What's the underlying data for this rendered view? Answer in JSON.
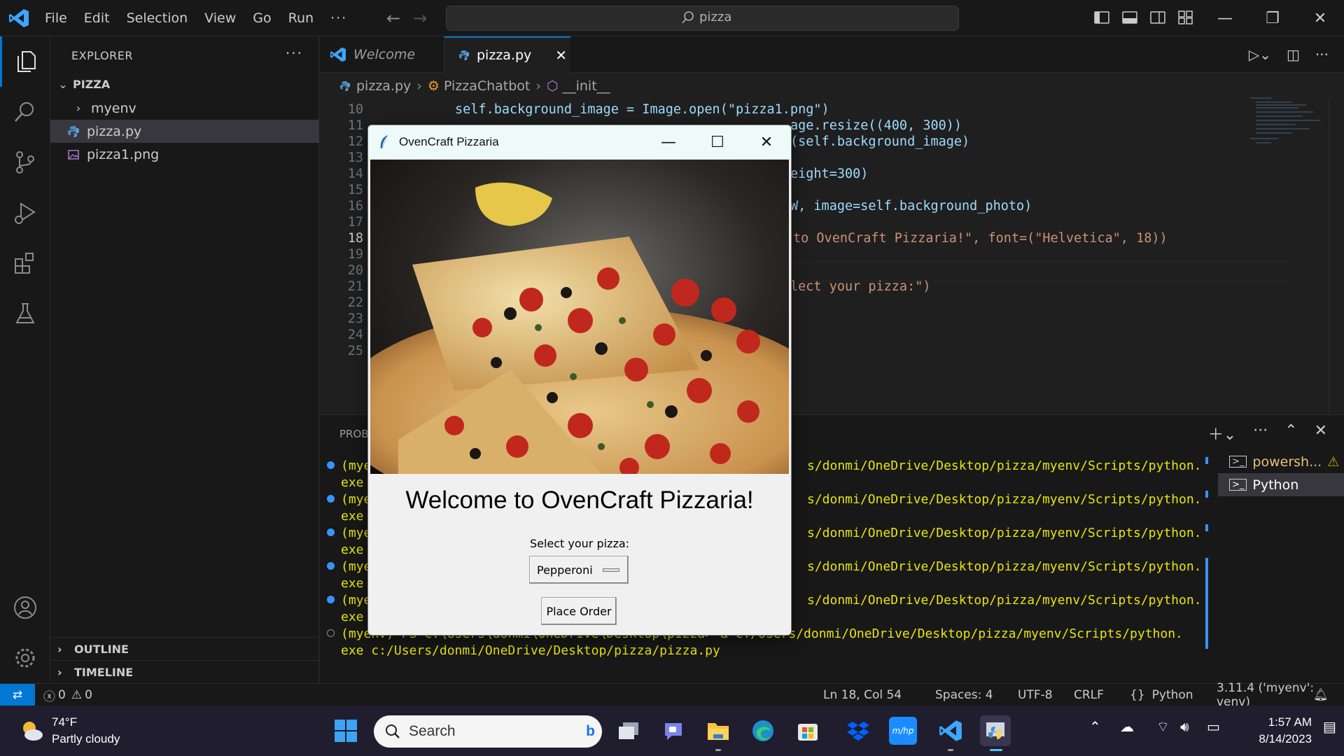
{
  "app": {
    "menu": [
      "File",
      "Edit",
      "Selection",
      "View",
      "Go",
      "Run"
    ],
    "search_text": "pizza",
    "accent": "#0078d4"
  },
  "explorer": {
    "header": "EXPLORER",
    "root": "PIZZA",
    "items": [
      {
        "label": "myenv",
        "type": "folder"
      },
      {
        "label": "pizza.py",
        "type": "python-file"
      },
      {
        "label": "pizza1.png",
        "type": "image-file"
      }
    ],
    "outline": "OUTLINE",
    "timeline": "TIMELINE"
  },
  "tabs": [
    {
      "label": "Welcome"
    },
    {
      "label": "pizza.py"
    }
  ],
  "breadcrumb": [
    "pizza.py",
    "PizzaChatbot",
    "__init__"
  ],
  "code": {
    "current_line": 18,
    "lines": [
      {
        "n": "10",
        "text": "self.background_image = Image.open(\"pizza1.png\")"
      },
      {
        "n": "11",
        "text": "age.resize((400, 300))"
      },
      {
        "n": "12",
        "text": "(self.background_image)"
      },
      {
        "n": "13",
        "text": ""
      },
      {
        "n": "14",
        "text": "eight=300)"
      },
      {
        "n": "15",
        "text": ""
      },
      {
        "n": "16",
        "text": "W, image=self.background_photo)"
      },
      {
        "n": "17",
        "text": ""
      },
      {
        "n": "18",
        "text": "to OvenCraft Pizzaria!\", font=(\"Helvetica\", 18))"
      },
      {
        "n": "19",
        "text": ""
      },
      {
        "n": "20",
        "text": ""
      },
      {
        "n": "21",
        "text": "lect your pizza:\")"
      },
      {
        "n": "22",
        "text": ""
      },
      {
        "n": "23",
        "text": ""
      },
      {
        "n": "24",
        "text": ""
      },
      {
        "n": "25",
        "text": ""
      }
    ]
  },
  "panel": {
    "tab_label": "PROB",
    "terminal_lines": [
      {
        "prefix": "(mye",
        "path": "s/donmi/OneDrive/Desktop/pizza/myenv/Scripts/python.",
        "cont": "exe",
        "dot": "blue"
      },
      {
        "prefix": "(mye",
        "path": "s/donmi/OneDrive/Desktop/pizza/myenv/Scripts/python.",
        "cont": "exe",
        "dot": "blue"
      },
      {
        "prefix": "(mye",
        "path": "s/donmi/OneDrive/Desktop/pizza/myenv/Scripts/python.",
        "cont": "exe",
        "dot": "blue"
      },
      {
        "prefix": "(mye",
        "path": "s/donmi/OneDrive/Desktop/pizza/myenv/Scripts/python.",
        "cont": "exe",
        "dot": "blue"
      },
      {
        "prefix": "(mye",
        "path": "s/donmi/OneDrive/Desktop/pizza/myenv/Scripts/python.",
        "cont": "exe",
        "dot": "blue"
      }
    ],
    "last_line": "(myenv) PS C:\\Users\\donmi\\OneDrive\\Desktop\\pizza> & c:/Users/donmi/OneDrive/Desktop/pizza/myenv/Scripts/python.",
    "last_line_cont": "exe c:/Users/donmi/OneDrive/Desktop/pizza/pizza.py",
    "terminals": [
      {
        "label": "powersh...",
        "warning": true
      },
      {
        "label": "Python",
        "warning": false
      }
    ]
  },
  "tk_window": {
    "title": "OvenCraft Pizzaria",
    "welcome": "Welcome to OvenCraft Pizzaria!",
    "select_label": "Select your pizza:",
    "selected_pizza": "Pepperoni",
    "order_button": "Place Order"
  },
  "status": {
    "errors": "0",
    "warnings": "0",
    "position": "Ln 18, Col 54",
    "spaces": "Spaces: 4",
    "encoding": "UTF-8",
    "eol": "CRLF",
    "language": "Python",
    "interpreter": "3.11.4 ('myenv': venv)"
  },
  "taskbar": {
    "temperature": "74°F",
    "condition": "Partly cloudy",
    "search_placeholder": "Search",
    "time": "1:57 AM",
    "date": "8/14/2023"
  }
}
